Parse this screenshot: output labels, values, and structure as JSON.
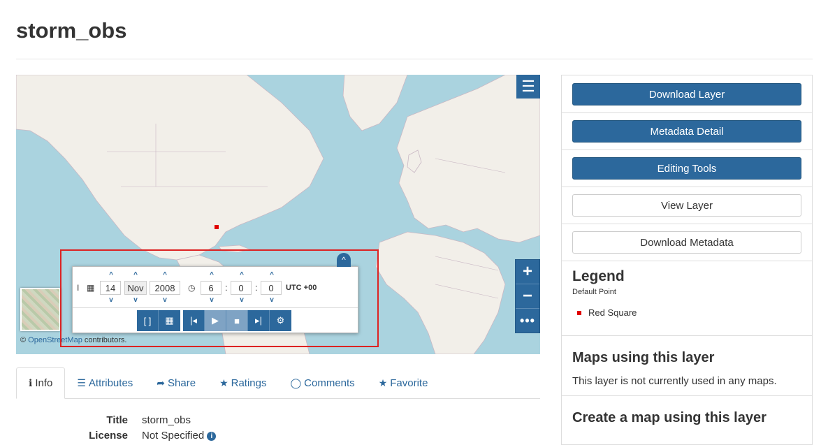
{
  "page": {
    "title": "storm_obs"
  },
  "map": {
    "menu_icon": "hamburger-icon",
    "zoom_in": "+",
    "zoom_out": "−",
    "more": "•••",
    "attribution_prefix": "© ",
    "attribution_link": "OpenStreetMap",
    "attribution_suffix": " contributors."
  },
  "time_widget": {
    "collapse": "^",
    "day": "14",
    "month": "Nov",
    "year": "2008",
    "hour": "6",
    "minute": "0",
    "second": "0",
    "timezone": "UTC +00",
    "chevron_up": "^",
    "chevron_down": "v",
    "separator": ":",
    "range_glyph": "[ ]",
    "buttons": {
      "first": "|◂",
      "play": "▶",
      "stop": "■",
      "last": "▸|",
      "settings": "⚙",
      "calendar_glyph": "▦"
    },
    "icons": [
      "cursor-icon",
      "calendar-icon",
      "clock-icon"
    ]
  },
  "tabs": [
    {
      "label": "Info",
      "icon": "info-icon",
      "glyph": "ℹ"
    },
    {
      "label": "Attributes",
      "icon": "list-icon",
      "glyph": "☰"
    },
    {
      "label": "Share",
      "icon": "share-icon",
      "glyph": "➦"
    },
    {
      "label": "Ratings",
      "icon": "star-icon",
      "glyph": "★"
    },
    {
      "label": "Comments",
      "icon": "comment-icon",
      "glyph": "💬"
    },
    {
      "label": "Favorite",
      "icon": "star-icon",
      "glyph": "★"
    }
  ],
  "info": {
    "title_label": "Title",
    "title_value": "storm_obs",
    "license_label": "License",
    "license_value": "Not Specified"
  },
  "sidebar": {
    "download_layer": "Download Layer",
    "metadata_detail": "Metadata Detail",
    "editing_tools": "Editing Tools",
    "view_layer": "View Layer",
    "download_metadata": "Download Metadata",
    "legend_title": "Legend",
    "legend_subtitle": "Default Point",
    "legend_item": "Red Square",
    "maps_title": "Maps using this layer",
    "maps_text": "This layer is not currently used in any maps.",
    "create_title": "Create a map using this layer"
  },
  "colors": {
    "primary": "#2c689c",
    "water": "#aad3df",
    "land": "#f2efe9",
    "marker": "#e00000",
    "highlight": "#d22222"
  }
}
